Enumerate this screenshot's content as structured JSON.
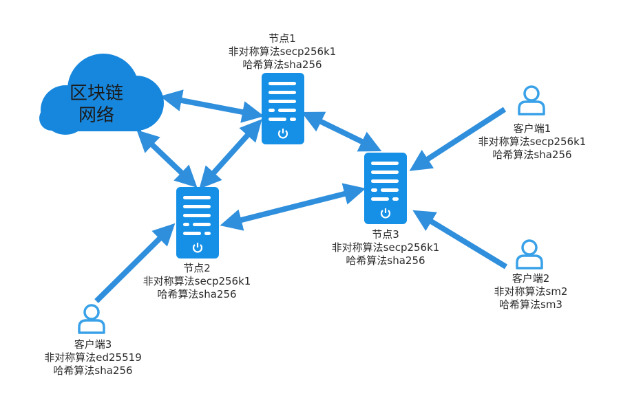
{
  "cloud": {
    "line1": "区块链",
    "line2": "网络"
  },
  "nodes": [
    {
      "name": "节点1",
      "asym": "非对称算法secp256k1",
      "hash": "哈希算法sha256"
    },
    {
      "name": "节点2",
      "asym": "非对称算法secp256k1",
      "hash": "哈希算法sha256"
    },
    {
      "name": "节点3",
      "asym": "非对称算法secp256k1",
      "hash": "哈希算法sha256"
    }
  ],
  "clients": [
    {
      "name": "客户端1",
      "asym": "非对称算法secp256k1",
      "hash": "哈希算法sha256"
    },
    {
      "name": "客户端2",
      "asym": "非对称算法sm2",
      "hash": "哈希算法sm3"
    },
    {
      "name": "客户端3",
      "asym": "非对称算法ed25519",
      "hash": "哈希算法sha256"
    }
  ],
  "colors": {
    "accent": "#2f8fdc",
    "cloud": "#1787dd",
    "server": "#1590e6",
    "client": "#39a1e8"
  },
  "icons": [
    "cloud-icon",
    "server-icon",
    "power-icon",
    "user-icon"
  ]
}
